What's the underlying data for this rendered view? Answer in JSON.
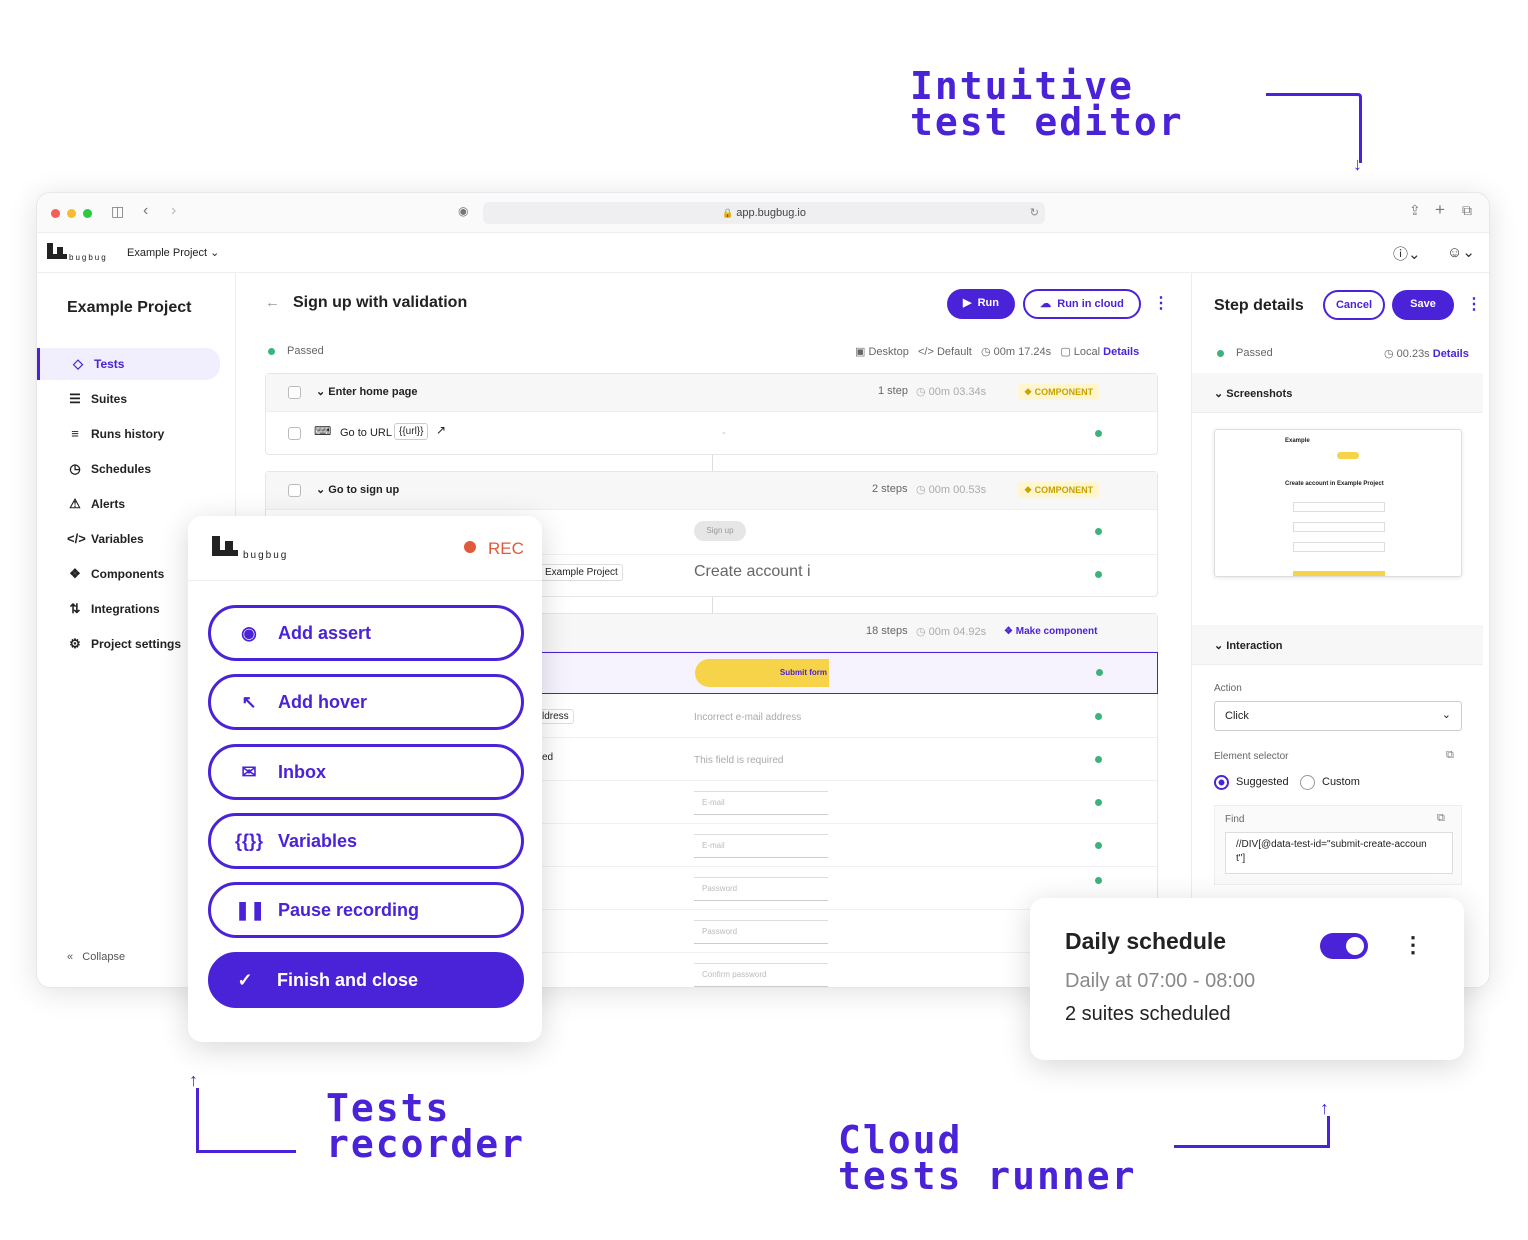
{
  "callouts": {
    "editor": [
      "Intuitive",
      "test editor"
    ],
    "recorder": [
      "Tests",
      "recorder"
    ],
    "cloud": [
      "Cloud",
      "tests runner"
    ]
  },
  "browser": {
    "url": "app.bugbug.io"
  },
  "app": {
    "logo_text": "bugbug",
    "project_switcher": "Example Project"
  },
  "sidebar": {
    "title": "Example Project",
    "items": [
      {
        "label": "Tests",
        "icon": "diamond-icon"
      },
      {
        "label": "Suites",
        "icon": "layers-icon"
      },
      {
        "label": "Runs history",
        "icon": "list-icon"
      },
      {
        "label": "Schedules",
        "icon": "clock-icon"
      },
      {
        "label": "Alerts",
        "icon": "alarm-icon"
      },
      {
        "label": "Variables",
        "icon": "code-icon"
      },
      {
        "label": "Components",
        "icon": "components-icon"
      },
      {
        "label": "Integrations",
        "icon": "integrations-icon"
      },
      {
        "label": "Project settings",
        "icon": "gear-icon"
      }
    ],
    "collapse": "Collapse"
  },
  "test": {
    "title": "Sign up with validation",
    "run": "Run",
    "run_cloud": "Run in cloud",
    "status": "Passed",
    "meta": {
      "device": "Desktop",
      "profile": "Default",
      "duration": "00m 17.24s",
      "env": "Local",
      "details": "Details"
    },
    "groups": [
      {
        "name": "Enter home page",
        "steps": "1 step",
        "time": "00m 03.34s",
        "badge": "COMPONENT"
      },
      {
        "name": "Go to sign up",
        "steps": "2 steps",
        "time": "00m 00.53s",
        "badge": "COMPONENT"
      },
      {
        "steps": "18 steps",
        "time": "00m 04.92s",
        "badge": "Make component"
      }
    ],
    "step_goto": {
      "label": "Go to URL",
      "var": "{{url}}",
      "dash": "-"
    },
    "previews": {
      "signup_btn": "Sign up",
      "project_chip": "Example Project",
      "create_account": "Create account i",
      "submit": "Submit form",
      "address_chip": "ldress",
      "required_chip": "ed",
      "err_email": "Incorrect e-mail address",
      "err_required": "This field is required",
      "f_email1": "E-mail",
      "f_email2": "E-mail",
      "f_pass1": "Password",
      "f_pass2": "Password",
      "f_confirm": "Confirm password"
    }
  },
  "step_details": {
    "title": "Step details",
    "cancel": "Cancel",
    "save": "Save",
    "status": "Passed",
    "duration": "00.23s",
    "details": "Details",
    "screenshots": "Screenshots",
    "interaction": "Interaction",
    "action_label": "Action",
    "action_value": "Click",
    "selector_label": "Element selector",
    "suggested": "Suggested",
    "custom": "Custom",
    "find_label": "Find",
    "find_value": "//DIV[@data-test-id=\"submit-create-account\"]",
    "shot": {
      "brand": "Example",
      "heading": "Create account in Example Project"
    }
  },
  "recorder": {
    "logo_text": "bugbug",
    "rec": "REC",
    "buttons": [
      {
        "label": "Add assert",
        "icon": "eye-icon"
      },
      {
        "label": "Add hover",
        "icon": "cursor-icon"
      },
      {
        "label": "Inbox",
        "icon": "mail-icon"
      },
      {
        "label": "Variables",
        "icon": "braces-icon"
      },
      {
        "label": "Pause recording",
        "icon": "pause-icon"
      }
    ],
    "finish": "Finish and close"
  },
  "schedule": {
    "title": "Daily schedule",
    "time": "Daily at 07:00 - 08:00",
    "suites": "2 suites scheduled",
    "enabled": true
  },
  "colors": {
    "accent": "#4a22d8",
    "success": "#3bb37a",
    "highlight": "#f7d34a",
    "rec": "#e05a3a"
  }
}
